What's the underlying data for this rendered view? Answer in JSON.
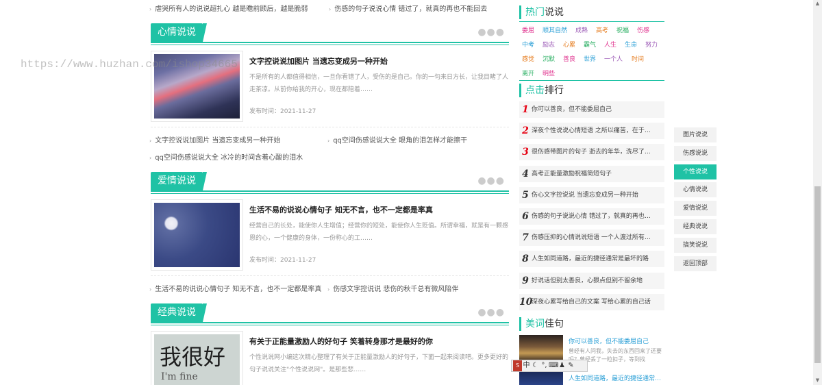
{
  "top_links": [
    "虐哭所有人的说说超扎心 越是瞻前顾后，越是脆弱",
    "伤感的句子说说心情 错过了，就真的再也不能回去"
  ],
  "sections": [
    {
      "tab": "心情说说",
      "article": {
        "title": "文字控说说加图片 当遗忘变成另一种开始",
        "desc": "不是所有的人都值得相信，一旦你看错了人，受伤的是自己。你的一句来日方长，让我目睹了人走茶凉。从前你给我的开心，现在都陪着……",
        "date": "发布时间：2021-11-27"
      },
      "links": [
        "文字控说说加图片 当遗忘变成另一种开始",
        "qq空间伤感说说大全 眼角的泪怎样才能擦干",
        "qq空间伤感说说大全 冰冷的时间含着心酸的泪水"
      ]
    },
    {
      "tab": "爱情说说",
      "article": {
        "title": "生活不易的说说心情句子 知无不言，也不一定都是率真",
        "desc": "经营自己的长处，能使你人生增值；经营你的短处，能使你人生贬值。所谓幸福，就是有一颗感恩的心，一个健康的身体，一份称心的工……",
        "date": "发布时间：2021-11-27"
      },
      "links": [
        "生活不易的说说心情句子 知无不言，也不一定都是率真",
        "伤感文字控说说 悲伤的秋千总有微风陪伴"
      ]
    },
    {
      "tab": "经典说说",
      "article": {
        "title": "有关于正能量激励人的好句子 笑着转身那才是最好的你",
        "desc": "个性说说网小编这次精心整理了有关于正能量激励人的好句子，下面一起来阅读吧。更多更好的句子说说关注\"个性说说网\"。是那些悲……",
        "image_text_1": "我很好",
        "image_text_2": "I'm fine"
      }
    }
  ],
  "watermark": "https://www.huzhan.com/ishop34665",
  "hot": {
    "title_hl": "热门",
    "title_rest": "说说",
    "tags": [
      {
        "text": "委屈",
        "color": "#e0338f"
      },
      {
        "text": "顺其自然",
        "color": "#2a9fd6"
      },
      {
        "text": "成熟",
        "color": "#9b59b6"
      },
      {
        "text": "高考",
        "color": "#e67e22"
      },
      {
        "text": "祝福",
        "color": "#27ae60"
      },
      {
        "text": "伤感",
        "color": "#e0338f"
      },
      {
        "text": "中考",
        "color": "#2a9fd6"
      },
      {
        "text": "励志",
        "color": "#9b59b6"
      },
      {
        "text": "心累",
        "color": "#e67e22"
      },
      {
        "text": "霸气",
        "color": "#27ae60"
      },
      {
        "text": "人生",
        "color": "#e0338f"
      },
      {
        "text": "生命",
        "color": "#2a9fd6"
      },
      {
        "text": "努力",
        "color": "#9b59b6"
      },
      {
        "text": "感觉",
        "color": "#e67e22"
      },
      {
        "text": "沉默",
        "color": "#27ae60"
      },
      {
        "text": "善良",
        "color": "#e0338f"
      },
      {
        "text": "世界",
        "color": "#2a9fd6"
      },
      {
        "text": "一个人",
        "color": "#9b59b6"
      },
      {
        "text": "时间",
        "color": "#e67e22"
      },
      {
        "text": "离开",
        "color": "#27ae60"
      },
      {
        "text": "明些",
        "color": "#e0338f"
      }
    ]
  },
  "ranking": {
    "title_hl": "点击",
    "title_rest": "排行",
    "items": [
      {
        "num": "1",
        "text": "你可以善良，但不能委屈自己"
      },
      {
        "num": "2",
        "text": "深夜个性说说心情短语 之所以痛苦，在于…"
      },
      {
        "num": "3",
        "text": "很伤感带图片的句子 逝去的年华，洗尽了…"
      },
      {
        "num": "4",
        "text": "高考正能量激励祝福简短句子"
      },
      {
        "num": "5",
        "text": "伤心文字控说说 当遗忘变成另一种开始"
      },
      {
        "num": "6",
        "text": "伤感的句子说说心情 错过了，就真的再也…"
      },
      {
        "num": "7",
        "text": "伤感压抑的心情说说短语 一个人渡过所有…"
      },
      {
        "num": "8",
        "text": "人生如同道路，最近的捷径通常是最坏的路"
      },
      {
        "num": "9",
        "text": "好说话但别太善良，心狠点但别不留余地"
      },
      {
        "num": "10",
        "text": "深夜心累写给自己的文案 写给心累的自己话"
      }
    ]
  },
  "meici": {
    "title_hl": "美词",
    "title_rest": "佳句",
    "items": [
      {
        "title": "你可以善良，但不能委屈自己",
        "desc": "曾经有人问我，失去的东西回来了还要吗？曾经丢了一粒扣子，等到找"
      },
      {
        "title": "人生如同道路，最近的捷径通常…",
        "desc": ""
      }
    ]
  },
  "float_nav": [
    {
      "label": "图片说说",
      "active": false
    },
    {
      "label": "伤感说说",
      "active": false
    },
    {
      "label": "个性说说",
      "active": true
    },
    {
      "label": "心情说说",
      "active": false
    },
    {
      "label": "爱情说说",
      "active": false
    },
    {
      "label": "经典说说",
      "active": false
    },
    {
      "label": "搞笑说说",
      "active": false
    },
    {
      "label": "返回顶部",
      "active": false
    }
  ],
  "ime": {
    "lang": "中",
    "icons": [
      "ime-logo-icon",
      "moon-icon",
      "punctuation-icon",
      "keyboard-icon",
      "user-icon",
      "wrench-icon"
    ]
  },
  "accent_color": "#1fc2a5"
}
